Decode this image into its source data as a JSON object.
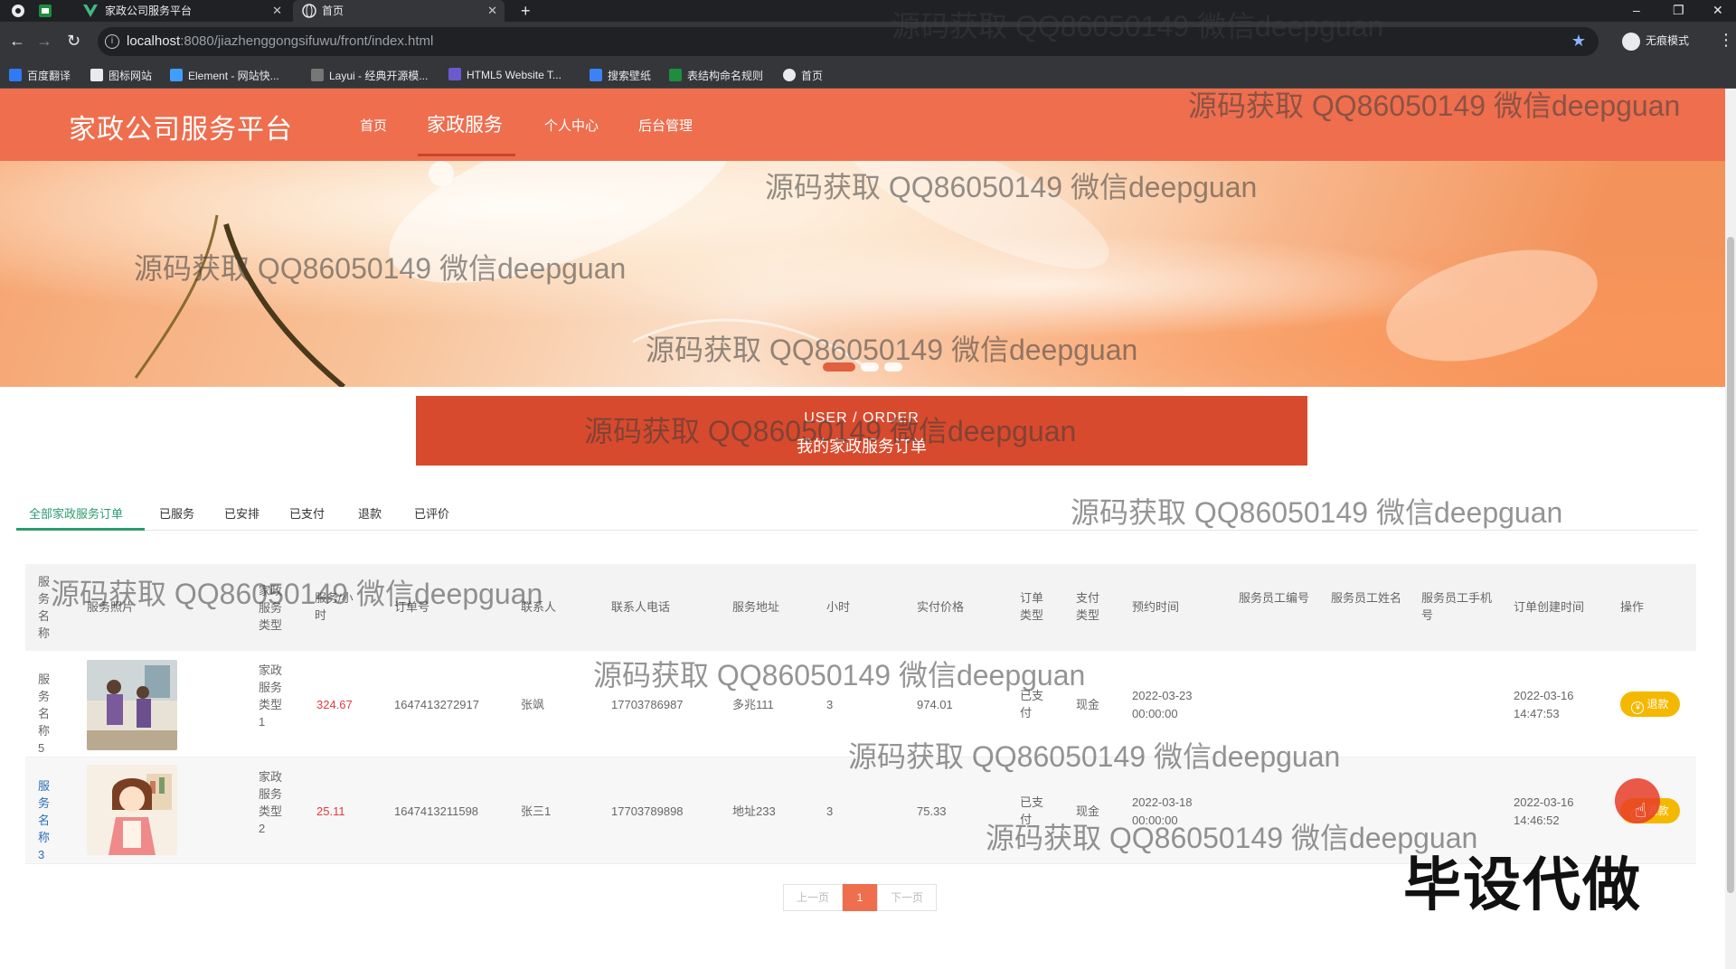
{
  "browser": {
    "tabs": [
      {
        "title": "家政公司服务平台"
      },
      {
        "title": "首页"
      }
    ],
    "new_tab": "+",
    "url_host": "localhost",
    "url_rest": ":8080/jiazhenggongsifuwu/front/index.html",
    "incognito": "无痕模式",
    "bookmarks": [
      "百度翻译",
      "图标网站",
      "Element - 网站快...",
      "Layui - 经典开源模...",
      "HTML5 Website T...",
      "搜索壁纸",
      "表结构命名规则",
      "首页"
    ]
  },
  "header": {
    "logo": "家政公司服务平台",
    "nav": [
      "首页",
      "家政服务",
      "个人中心",
      "后台管理"
    ],
    "active_nav": "家政服务"
  },
  "order_banner": {
    "en": "USER / ORDER",
    "cn": "我的家政服务订单"
  },
  "order_tabs": [
    "全部家政服务订单",
    "已服务",
    "已安排",
    "已支付",
    "退款",
    "已评价"
  ],
  "table": {
    "headers": [
      "服务名称",
      "服务照片",
      "家政服务类型",
      "服务/小时",
      "订单号",
      "联系人",
      "联系人电话",
      "服务地址",
      "小时",
      "实付价格",
      "订单类型",
      "支付类型",
      "预约时间",
      "服务员工编号",
      "服务员工姓名",
      "服务员工手机号",
      "订单创建时间",
      "操作"
    ],
    "rows": [
      {
        "name": "服务名称5",
        "type": "家政服务类型1",
        "price_per_hour": "324.67",
        "order_no": "1647413272917",
        "contact": "张飒",
        "phone": "17703786987",
        "address": "多兆111",
        "hours": "3",
        "paid": "974.01",
        "order_type": "已支付",
        "pay_type": "现金",
        "appoint_date": "2022-03-23",
        "appoint_time": "00:00:00",
        "emp_no": "",
        "emp_name": "",
        "emp_phone": "",
        "created_date": "2022-03-16",
        "created_time": "14:47:53",
        "action": "退款"
      },
      {
        "name": "服务名称3",
        "type": "家政服务类型2",
        "price_per_hour": "25.11",
        "order_no": "1647413211598",
        "contact": "张三1",
        "phone": "17703789898",
        "address": "地址233",
        "hours": "3",
        "paid": "75.33",
        "order_type": "已支付",
        "pay_type": "现金",
        "appoint_date": "2022-03-18",
        "appoint_time": "00:00:00",
        "emp_no": "",
        "emp_name": "",
        "emp_phone": "",
        "created_date": "2022-03-16",
        "created_time": "14:46:52",
        "action": "退款"
      }
    ]
  },
  "pager": {
    "prev": "上一页",
    "current": "1",
    "next": "下一页"
  },
  "watermark": "源码获取 QQ86050149 微信deepguan",
  "stamp": "毕设代做",
  "colors": {
    "header": "#ee6e4e",
    "order_banner": "#d84a2d",
    "tab_active": "#2b9b6f",
    "price": "#e4393c",
    "refund_button": "#f5b800"
  }
}
